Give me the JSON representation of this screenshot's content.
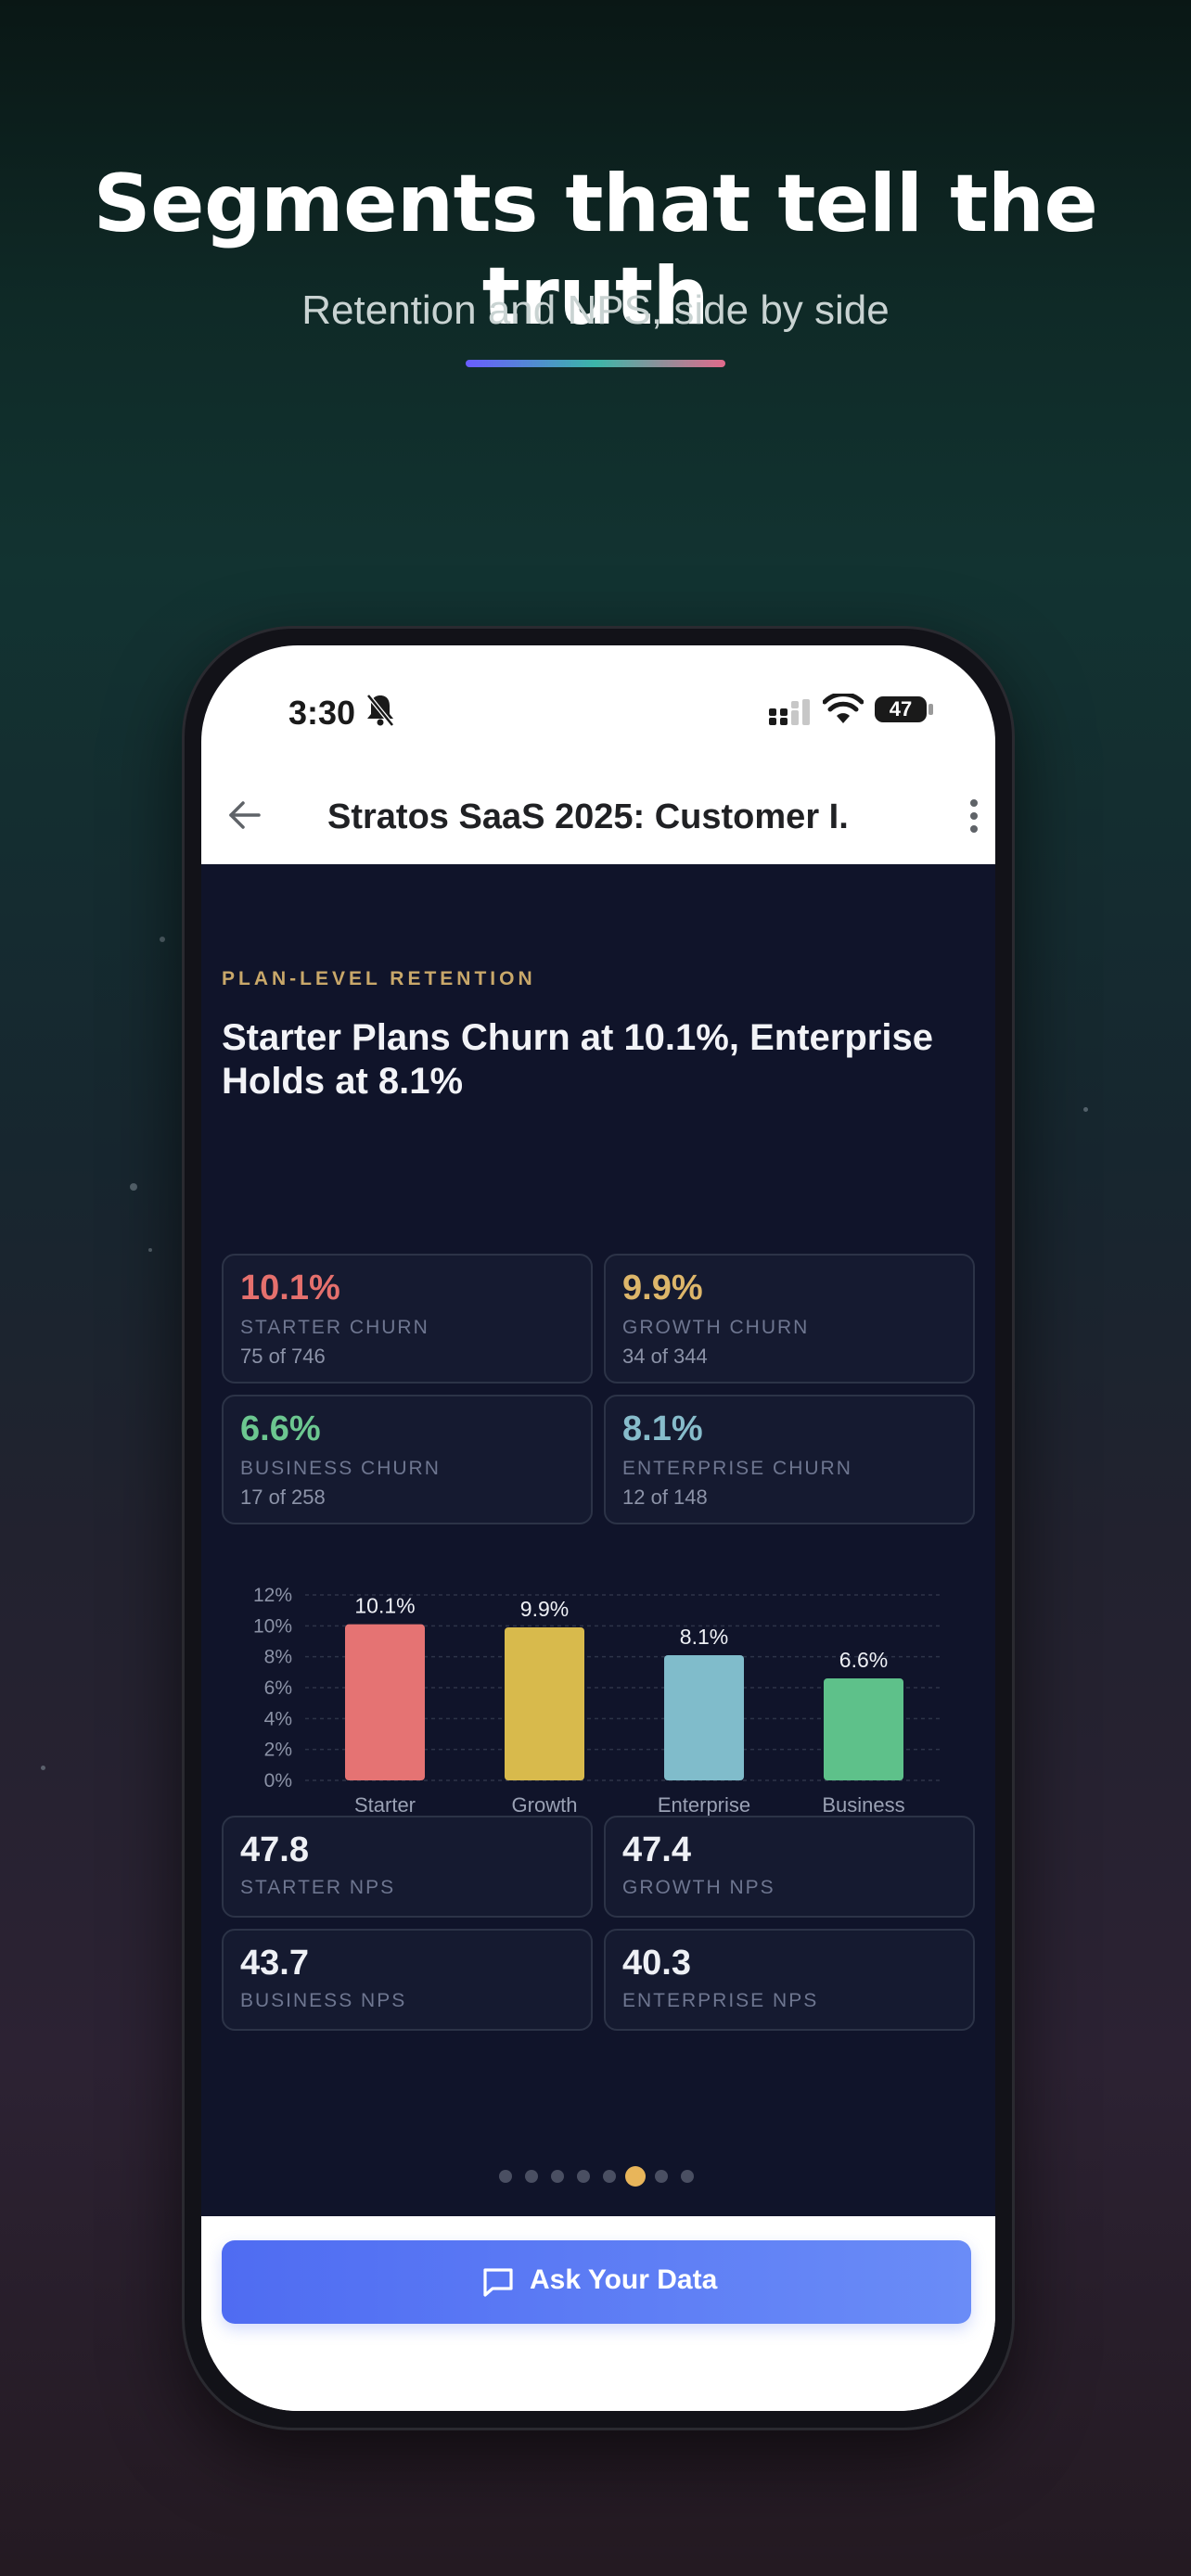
{
  "promo": {
    "title": "Segments that tell the truth",
    "subtitle": "Retention and NPS, side by side"
  },
  "status_bar": {
    "time": "3:30",
    "battery": "47"
  },
  "app_bar": {
    "title": "Stratos SaaS 2025: Customer I..."
  },
  "slide": {
    "kicker": "PLAN-LEVEL RETENTION",
    "headline": "Starter Plans Churn at 10.1%, Enterprise Holds at 8.1%"
  },
  "churn_cards": [
    {
      "value": "10.1%",
      "label": "STARTER CHURN",
      "sub": "75 of 746",
      "color": "#e5706d"
    },
    {
      "value": "9.9%",
      "label": "GROWTH CHURN",
      "sub": "34 of 344",
      "color": "#ddb66a"
    },
    {
      "value": "6.6%",
      "label": "BUSINESS CHURN",
      "sub": "17 of 258",
      "color": "#6cc790"
    },
    {
      "value": "8.1%",
      "label": "ENTERPRISE CHURN",
      "sub": "12 of 148",
      "color": "#87bccb"
    }
  ],
  "nps_cards": [
    {
      "value": "47.8",
      "label": "STARTER NPS"
    },
    {
      "value": "47.4",
      "label": "GROWTH NPS"
    },
    {
      "value": "43.7",
      "label": "BUSINESS NPS"
    },
    {
      "value": "40.3",
      "label": "ENTERPRISE NPS"
    }
  ],
  "chart_data": {
    "type": "bar",
    "categories": [
      "Starter",
      "Growth",
      "Enterprise",
      "Business"
    ],
    "values": [
      10.1,
      9.9,
      8.1,
      6.6
    ],
    "data_labels": [
      "10.1%",
      "9.9%",
      "8.1%",
      "6.6%"
    ],
    "colors": [
      "#e57373",
      "#d8ba4c",
      "#80bccb",
      "#5ec18a"
    ],
    "ylim": [
      0,
      12
    ],
    "yticks": [
      0,
      2,
      4,
      6,
      8,
      10,
      12
    ],
    "ytick_labels": [
      "0%",
      "2%",
      "4%",
      "6%",
      "8%",
      "10%",
      "12%"
    ],
    "grid": true,
    "title": "",
    "xlabel": "",
    "ylabel": ""
  },
  "pager": {
    "count": 8,
    "active_index": 5
  },
  "footer": {
    "ask_label": "Ask Your Data"
  }
}
